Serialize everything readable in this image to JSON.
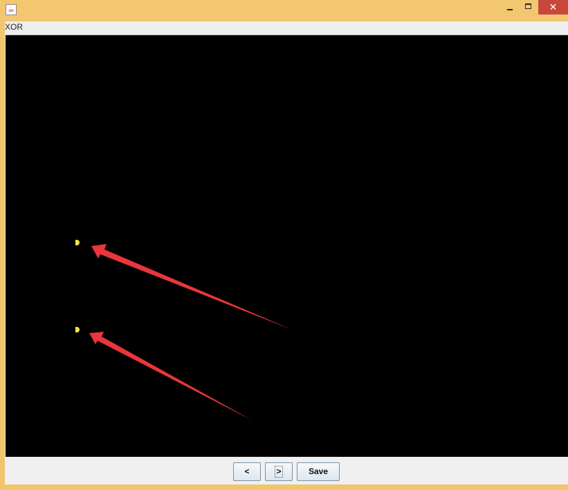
{
  "window": {
    "app_icon": "java-cup-icon",
    "controls": {
      "minimize": "–",
      "maximize": "□",
      "close": "✕"
    }
  },
  "panel": {
    "title": "XOR"
  },
  "buttons": {
    "prev_label": "<",
    "next_label": ">",
    "save_label": "Save"
  },
  "colors": {
    "titlebar": "#f2c770",
    "canvas_background": "#000000",
    "point_color": "#f3e53a",
    "annotation_arrow": "#e8363a"
  }
}
